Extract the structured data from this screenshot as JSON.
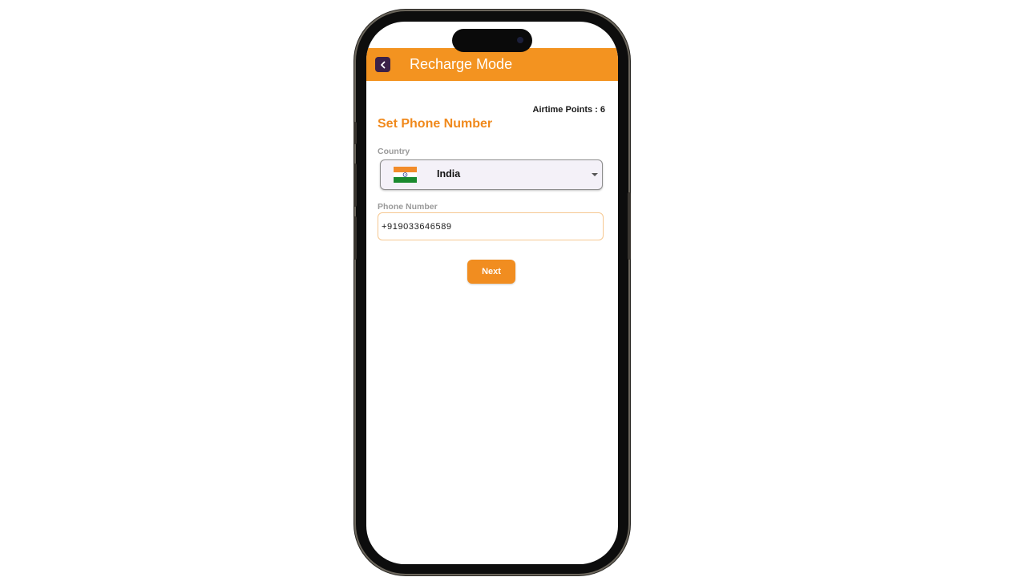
{
  "appbar": {
    "title": "Recharge Mode",
    "back_icon": "chevron-left-icon",
    "color": "#f39320"
  },
  "points": {
    "label": "Airtime Points : 6"
  },
  "form": {
    "title": "Set Phone Number",
    "country_label": "Country",
    "country_value": "India",
    "country_flag": "india-flag-icon",
    "phone_label": "Phone Number",
    "phone_value": "+919033646589",
    "next_label": "Next"
  },
  "colors": {
    "accent": "#f18d20",
    "title": "#f0891c",
    "back_button": "#3b2148"
  }
}
